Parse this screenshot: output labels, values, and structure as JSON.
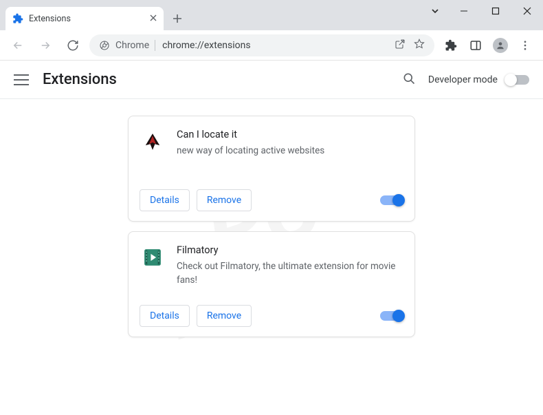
{
  "window": {
    "tab_title": "Extensions"
  },
  "omnibox": {
    "site_label": "Chrome",
    "url": "chrome://extensions"
  },
  "header": {
    "title": "Extensions",
    "dev_mode_label": "Developer mode",
    "dev_mode_on": false
  },
  "buttons": {
    "details": "Details",
    "remove": "Remove"
  },
  "extensions": [
    {
      "name": "Can I locate it",
      "description": "new way of locating active websites",
      "enabled": true,
      "icon": "phoenix"
    },
    {
      "name": "Filmatory",
      "description": "Check out Filmatory, the ultimate extension for movie fans!",
      "enabled": true,
      "icon": "film"
    }
  ],
  "watermark": {
    "line1": "PC",
    "line2": "risk.com"
  }
}
